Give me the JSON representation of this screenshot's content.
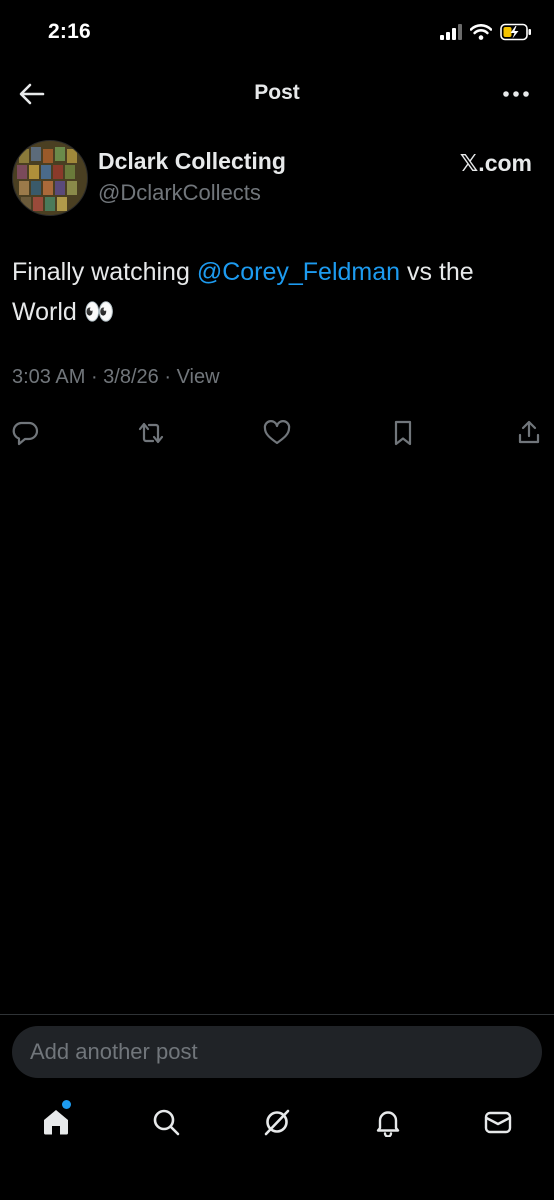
{
  "status_bar": {
    "time": "2:16"
  },
  "header": {
    "title": "Post"
  },
  "author": {
    "name": "Dclark Collecting",
    "handle": "@DclarkCollects",
    "source": "𝕏.com"
  },
  "post": {
    "text_before": "Finally watching ",
    "mention": "@Corey_Feldman",
    "text_after": " vs the World 👀",
    "time": "3:03 AM",
    "date": "3/8/26",
    "views_label": "View"
  },
  "reply": {
    "placeholder": "Add another post"
  },
  "colors": {
    "background": "#000000",
    "text": "#e7e9ea",
    "secondary": "#71767b",
    "accent": "#1d9bf0"
  },
  "icons": {
    "back": "arrow-left-icon",
    "more": "more-horizontal-icon",
    "reply": "reply-icon",
    "repost": "repost-icon",
    "like": "heart-icon",
    "bookmark": "bookmark-icon",
    "share": "share-icon",
    "home": "home-icon",
    "search": "search-icon",
    "grok": "grok-icon",
    "notifications": "bell-icon",
    "messages": "mail-icon"
  }
}
